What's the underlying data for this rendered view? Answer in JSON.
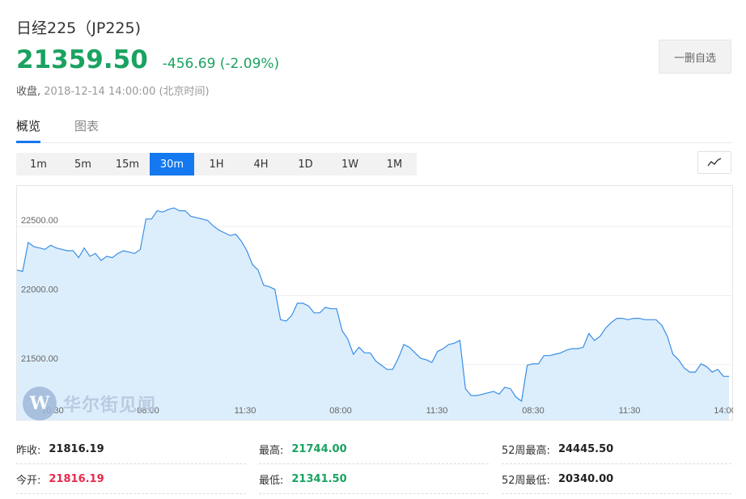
{
  "header": {
    "title": "日经225（JP225)",
    "price": "21359.50",
    "change": "-456.69 (-2.09%)",
    "status_label": "收盘,",
    "status_time": "2018-12-14 14:00:00 (北京时间)",
    "watch_button": "一删自选"
  },
  "tabs": [
    {
      "label": "概览",
      "active": true
    },
    {
      "label": "图表",
      "active": false
    }
  ],
  "periods": [
    {
      "label": "1m",
      "active": false
    },
    {
      "label": "5m",
      "active": false
    },
    {
      "label": "15m",
      "active": false
    },
    {
      "label": "30m",
      "active": true
    },
    {
      "label": "1H",
      "active": false
    },
    {
      "label": "4H",
      "active": false
    },
    {
      "label": "1D",
      "active": false
    },
    {
      "label": "1W",
      "active": false
    },
    {
      "label": "1M",
      "active": false
    }
  ],
  "chart_type_icon": "line-chart-icon",
  "watermark": {
    "logo_letter": "W",
    "text": "华尔街见闻"
  },
  "colors": {
    "accent": "#1478f0",
    "up_green": "#1aa260",
    "down_red": "#e8294c",
    "chart_line": "#3a8ee6",
    "chart_fill": "#dceefc"
  },
  "chart_data": {
    "type": "area",
    "y_ticks": [
      "22500.00",
      "22000.00",
      "21500.00"
    ],
    "x_ticks": [
      "10:30",
      "08:00",
      "11:30",
      "08:00",
      "11:30",
      "08:30",
      "11:30",
      "14:00"
    ],
    "ylim": [
      21100,
      22800
    ],
    "values": [
      22185,
      22175,
      22385,
      22355,
      22345,
      22335,
      22365,
      22345,
      22335,
      22325,
      22325,
      22275,
      22345,
      22285,
      22305,
      22255,
      22285,
      22275,
      22305,
      22325,
      22315,
      22305,
      22335,
      22555,
      22555,
      22615,
      22605,
      22625,
      22635,
      22615,
      22615,
      22575,
      22565,
      22555,
      22545,
      22505,
      22475,
      22455,
      22435,
      22445,
      22395,
      22325,
      22225,
      22185,
      22075,
      22065,
      22045,
      21825,
      21815,
      21855,
      21945,
      21945,
      21925,
      21875,
      21875,
      21915,
      21905,
      21905,
      21745,
      21685,
      21575,
      21625,
      21585,
      21585,
      21525,
      21495,
      21465,
      21465,
      21545,
      21645,
      21625,
      21585,
      21545,
      21535,
      21515,
      21595,
      21615,
      21645,
      21655,
      21675,
      21325,
      21275,
      21275,
      21285,
      21295,
      21305,
      21285,
      21335,
      21325,
      21265,
      21235,
      21495,
      21505,
      21505,
      21565,
      21565,
      21575,
      21585,
      21605,
      21615,
      21615,
      21625,
      21725,
      21675,
      21705,
      21765,
      21805,
      21835,
      21835,
      21825,
      21835,
      21835,
      21825,
      21825,
      21825,
      21785,
      21705,
      21575,
      21535,
      21475,
      21445,
      21445,
      21505,
      21485,
      21445,
      21465,
      21415,
      21415
    ]
  },
  "stats": {
    "prev_close_label": "昨收:",
    "prev_close": "21816.19",
    "open_label": "今开:",
    "open": "21816.19",
    "high_label": "最高:",
    "high": "21744.00",
    "low_label": "最低:",
    "low": "21341.50",
    "wk52_high_label": "52周最高:",
    "wk52_high": "24445.50",
    "wk52_low_label": "52周最低:",
    "wk52_low": "20340.00"
  }
}
